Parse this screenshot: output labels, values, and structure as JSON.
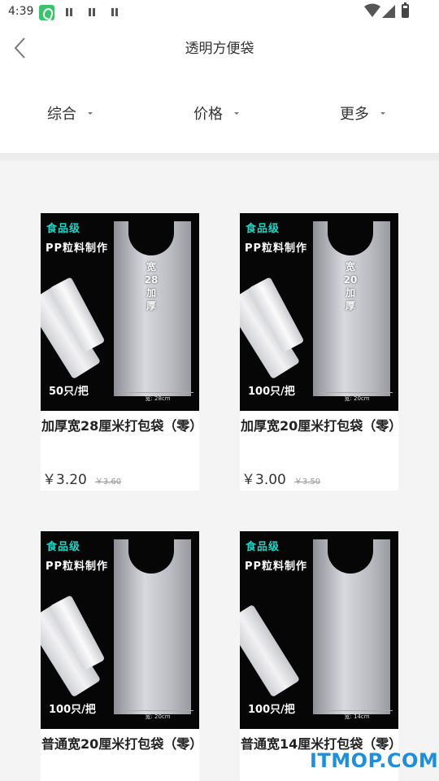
{
  "status_bar": {
    "time": "4:39"
  },
  "header": {
    "title": "透明方便袋"
  },
  "sort_bar": {
    "items": [
      {
        "label": "综合"
      },
      {
        "label": "价格"
      },
      {
        "label": "更多"
      }
    ]
  },
  "products": [
    {
      "name": "加厚宽28厘米打包袋（零）",
      "price": "￥3.20",
      "original_price": "￥3.60",
      "image": {
        "food_text": "食品级",
        "material_text": "PP粒料制作",
        "count_text": "50只/把",
        "badge_text": "宽28加厚",
        "width_text": "宽: 28cm"
      }
    },
    {
      "name": "加厚宽20厘米打包袋（零）",
      "price": "￥3.00",
      "original_price": "￥3.50",
      "image": {
        "food_text": "食品级",
        "material_text": "PP粒料制作",
        "count_text": "100只/把",
        "badge_text": "宽20加厚",
        "width_text": "宽: 20cm"
      }
    },
    {
      "name": "普通宽20厘米打包袋（零）",
      "price": "",
      "original_price": "",
      "image": {
        "food_text": "食品级",
        "material_text": "PP粒料制作",
        "count_text": "100只/把",
        "badge_text": "",
        "width_text": "宽: 20cm"
      }
    },
    {
      "name": "普通宽14厘米打包袋（零）",
      "price": "",
      "original_price": "",
      "image": {
        "food_text": "食品级",
        "material_text": "PP粒料制作",
        "count_text": "100只/把",
        "badge_text": "",
        "width_text": "宽: 14cm"
      }
    }
  ],
  "watermark": {
    "text": "ITMOP.COM"
  }
}
